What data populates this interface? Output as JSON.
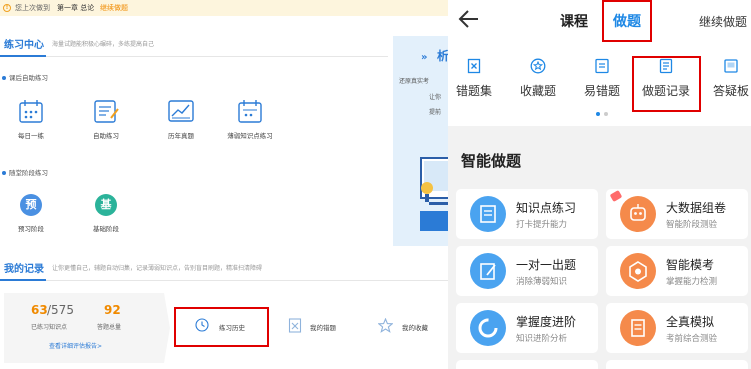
{
  "left": {
    "topbar": {
      "last_studied_label": "您上次做到",
      "chapter": "第一章 总论",
      "continue_link": "继续做题"
    },
    "practice_center": {
      "title": "练习中心",
      "desc": "海量试题能积极心碾碎，多练提高自己",
      "after_class": {
        "heading": "课后自助练习",
        "items": [
          {
            "label": "每日一练",
            "icon": "calendar-icon"
          },
          {
            "label": "自助练习",
            "icon": "notebook-icon"
          },
          {
            "label": "历年真题",
            "icon": "chart-icon"
          },
          {
            "label": "薄弱知识点练习",
            "icon": "calendar-check-icon"
          }
        ]
      },
      "stage": {
        "heading": "随堂阶段练习",
        "items": [
          {
            "label": "预习阶段",
            "glyph": "预",
            "color": "#4a90e2"
          },
          {
            "label": "基础阶段",
            "glyph": "基",
            "color": "#2bb39a"
          }
        ]
      }
    },
    "banner": {
      "arrows": "»",
      "big_char": "析",
      "lines": [
        "还原真实考",
        "让你",
        "提前"
      ]
    },
    "my_records": {
      "title": "我的记录",
      "desc": "让你更懂自己，辅题自动归集，记录薄弱知识点，告别盲目刷题，精准扫清障碍",
      "done_count": "63",
      "total_count": "/575",
      "done_label": "已练习知识点",
      "answered_count": "92",
      "answered_label": "答题总量",
      "report_link": "查看详细评估报告>",
      "items": [
        {
          "label": "练习历史",
          "icon": "clock-icon"
        },
        {
          "label": "我的错题",
          "icon": "wrong-note-icon"
        },
        {
          "label": "我的收藏",
          "icon": "star-icon"
        }
      ]
    }
  },
  "right": {
    "tabs": {
      "course": "课程",
      "practice": "做题",
      "continue": "继续做题"
    },
    "tools": [
      {
        "label": "错题集",
        "icon": "wrong-set-icon"
      },
      {
        "label": "收藏题",
        "icon": "star-circle-icon"
      },
      {
        "label": "易错题",
        "icon": "error-prone-icon"
      },
      {
        "label": "做题记录",
        "icon": "record-icon"
      },
      {
        "label": "答疑板",
        "icon": "qa-board-icon"
      }
    ],
    "smart_title": "智能做题",
    "cards": [
      {
        "title": "知识点练习",
        "sub": "打卡提升能力",
        "color": "#4aa3f0",
        "icon": "knowledge-icon"
      },
      {
        "title": "大数据组卷",
        "sub": "智能阶段测验",
        "color": "#f58a4b",
        "icon": "robot-icon"
      },
      {
        "title": "一对一出题",
        "sub": "消除薄弱知识",
        "color": "#4aa3f0",
        "icon": "pen-icon"
      },
      {
        "title": "智能模考",
        "sub": "掌握能力检测",
        "color": "#f58a4b",
        "icon": "target-icon"
      },
      {
        "title": "掌握度进阶",
        "sub": "知识进阶分析",
        "color": "#4aa3f0",
        "icon": "progress-ring-icon"
      },
      {
        "title": "全真模拟",
        "sub": "考前综合测验",
        "color": "#f58a4b",
        "icon": "paper-icon"
      }
    ]
  },
  "colors": {
    "accent_blue": "#1e88e5",
    "highlight_red": "#e00000",
    "orange": "#f58a4b",
    "stat_orange": "#f08a00"
  }
}
